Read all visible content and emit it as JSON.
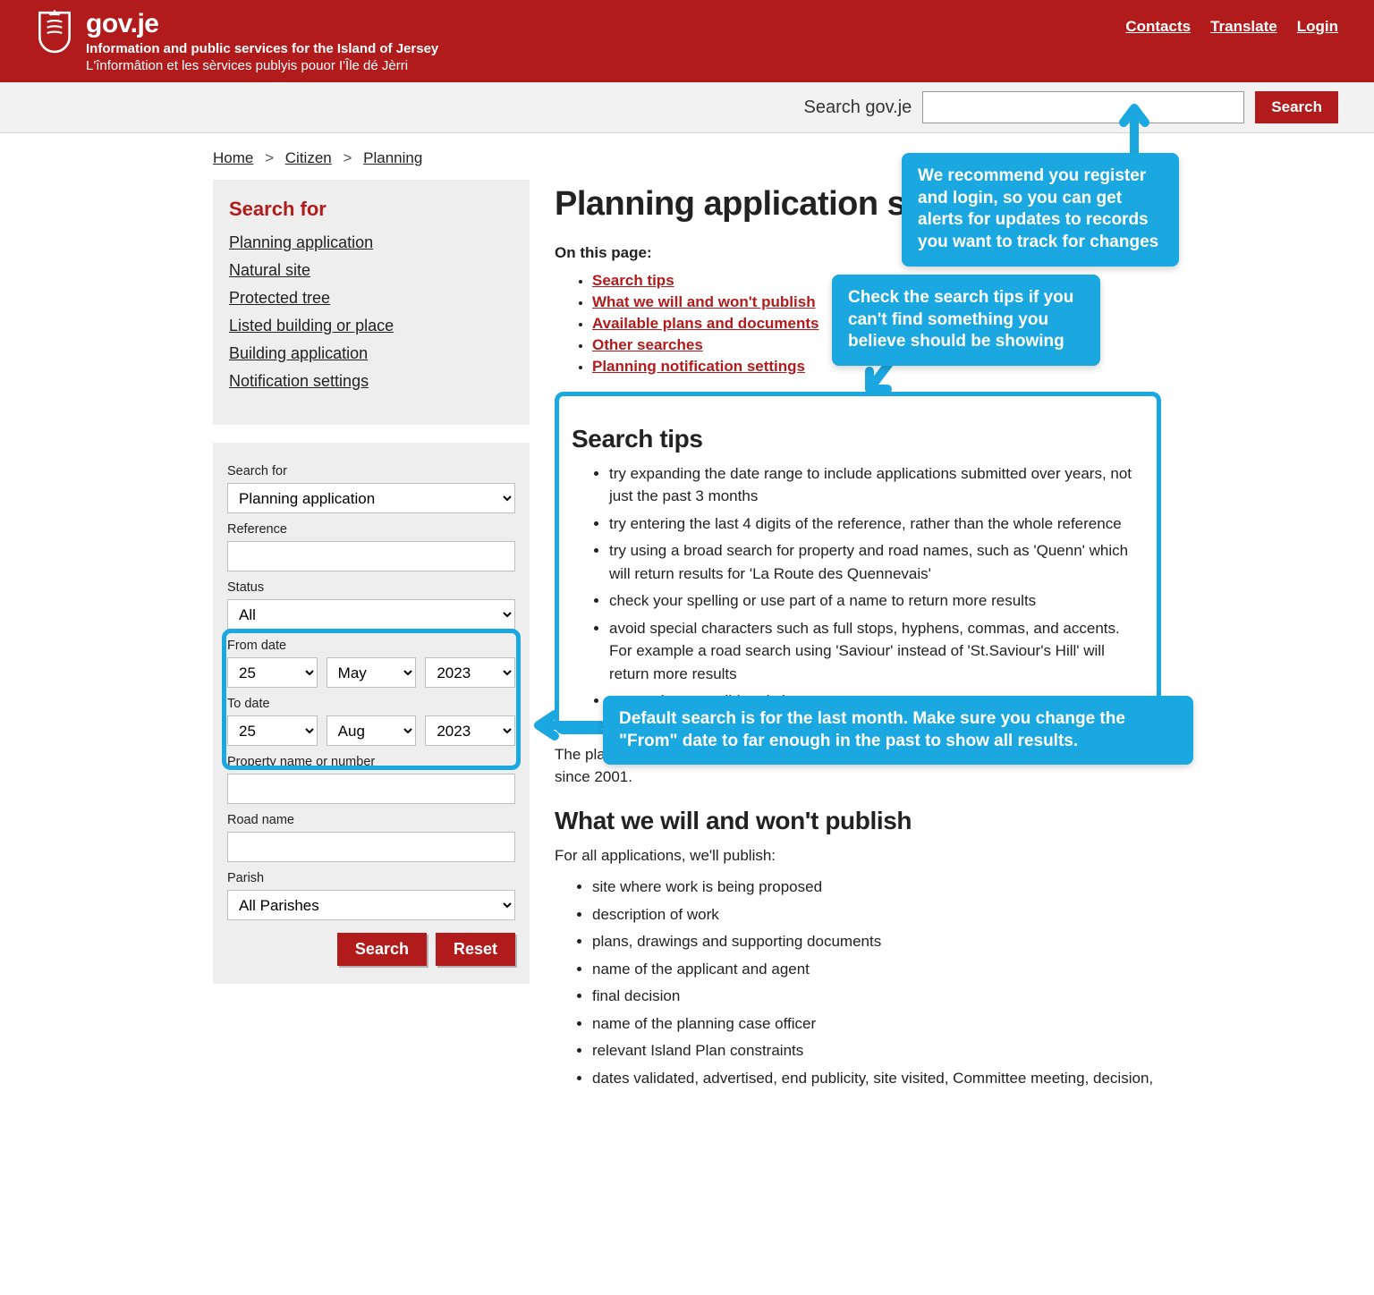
{
  "header": {
    "site": "gov.je",
    "line1": "Information and public services for the Island of Jersey",
    "line2": "L'înformâtion et les sèrvices publyis pouor I'Île dé Jèrri",
    "links": {
      "contacts": "Contacts",
      "translate": "Translate",
      "login": "Login"
    }
  },
  "searchbar": {
    "label": "Search gov.je",
    "button": "Search"
  },
  "breadcrumb": {
    "home": "Home",
    "citizen": "Citizen",
    "planning": "Planning"
  },
  "sidebar": {
    "title": "Search for",
    "links": {
      "planning_app": "Planning application",
      "natural_site": "Natural site",
      "protected_tree": "Protected tree",
      "listed": "Listed building or place",
      "building_app": "Building application",
      "notification": "Notification settings"
    }
  },
  "form": {
    "search_for_label": "Search for",
    "search_for_value": "Planning application",
    "reference_label": "Reference",
    "reference_value": "",
    "status_label": "Status",
    "status_value": "All",
    "from_label": "From date",
    "from_day": "25",
    "from_month": "May",
    "from_year": "2023",
    "to_label": "To date",
    "to_day": "25",
    "to_month": "Aug",
    "to_year": "2023",
    "property_label": "Property name or number",
    "property_value": "",
    "road_label": "Road name",
    "road_value": "",
    "parish_label": "Parish",
    "parish_value": "All Parishes",
    "search_btn": "Search",
    "reset_btn": "Reset"
  },
  "main": {
    "h1": "Planning application search",
    "on_this_page": "On this page:",
    "toc": {
      "tips": "Search tips",
      "publish": "What we will and won't publish",
      "plans": "Available plans and documents",
      "other": "Other searches",
      "notif": "Planning notification settings"
    },
    "tips_h2": "Search tips",
    "tips": {
      "t1": "try expanding the date range to include applications submitted over years, not just the past 3 months",
      "t2": "try entering the last 4 digits of the reference, rather than the whole reference",
      "t3": "try using a broad search for property and road names, such as 'Quenn' which will return results for 'La Route des Quennevais'",
      "t4": "check your spelling or use part of a name to return more results",
      "t5": "avoid special characters such as full stops, hyphens, commas, and accents. For example a road search using 'Saviour' instead of 'St.Saviour's Hill' will return more results",
      "t6": "no need to use wildcard characters"
    },
    "db_intro": "The planning application database contains records of all planning applications made since 2001.",
    "publish_h2": "What we will and won't publish",
    "publish_intro": "For all applications, we'll publish:",
    "publish": {
      "p1": "site where work is being proposed",
      "p2": "description of work",
      "p3": "plans, drawings and supporting documents",
      "p4": "name of the applicant and agent",
      "p5": "final decision",
      "p6": "name of the planning case officer",
      "p7": "relevant Island Plan constraints",
      "p8": "dates validated, advertised, end publicity, site visited, Committee meeting, decision,"
    }
  },
  "callouts": {
    "login": "We recommend you register and login, so you can get alerts for updates to records you want to track for changes",
    "tips": "Check the search tips if you can't find something you believe should be showing",
    "dates": "Default search is for the last month. Make sure you change the \"From\" date to far enough in the past to show all results."
  }
}
